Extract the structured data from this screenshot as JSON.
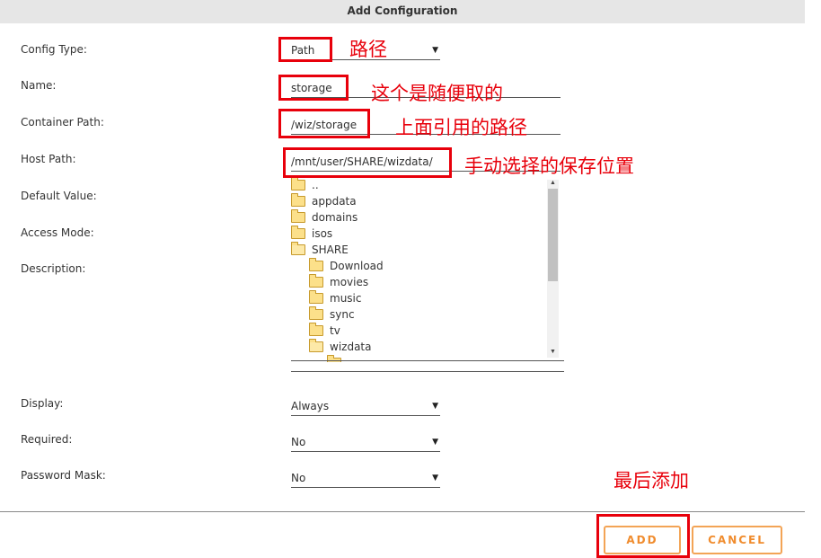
{
  "dialog": {
    "title": "Add Configuration"
  },
  "form": {
    "config_type": {
      "label": "Config Type:",
      "value": "Path"
    },
    "name": {
      "label": "Name:",
      "value": "storage"
    },
    "container_path": {
      "label": "Container Path:",
      "value": "/wiz/storage"
    },
    "host_path": {
      "label": "Host Path:",
      "value": "/mnt/user/SHARE/wizdata/"
    },
    "default_value": {
      "label": "Default Value:"
    },
    "access_mode": {
      "label": "Access Mode:"
    },
    "description": {
      "label": "Description:"
    },
    "display": {
      "label": "Display:",
      "value": "Always"
    },
    "required": {
      "label": "Required:",
      "value": "No"
    },
    "password_mask": {
      "label": "Password Mask:",
      "value": "No"
    }
  },
  "file_tree": {
    "items": [
      {
        "name": "..",
        "level": 0,
        "open": false
      },
      {
        "name": "appdata",
        "level": 0,
        "open": false
      },
      {
        "name": "domains",
        "level": 0,
        "open": false
      },
      {
        "name": "isos",
        "level": 0,
        "open": false
      },
      {
        "name": "SHARE",
        "level": 0,
        "open": true
      },
      {
        "name": "Download",
        "level": 1,
        "open": false
      },
      {
        "name": "movies",
        "level": 1,
        "open": false
      },
      {
        "name": "music",
        "level": 1,
        "open": false
      },
      {
        "name": "sync",
        "level": 1,
        "open": false
      },
      {
        "name": "tv",
        "level": 1,
        "open": false
      },
      {
        "name": "wizdata",
        "level": 1,
        "open": true
      },
      {
        "name": "",
        "level": 2,
        "open": false
      }
    ]
  },
  "annotations": {
    "path": "路径",
    "name": "这个是随便取的",
    "container_path": "上面引用的路径",
    "host_path": "手动选择的保存位置",
    "add": "最后添加"
  },
  "buttons": {
    "add": "ADD",
    "cancel": "CANCEL"
  },
  "icons": {
    "dropdown": "caret-down-icon",
    "folder": "folder-icon",
    "folder_open": "folder-open-icon"
  },
  "colors": {
    "highlight": "#e8000b",
    "button_accent": "#f08c2e",
    "header_bg": "#e6e6e6"
  }
}
